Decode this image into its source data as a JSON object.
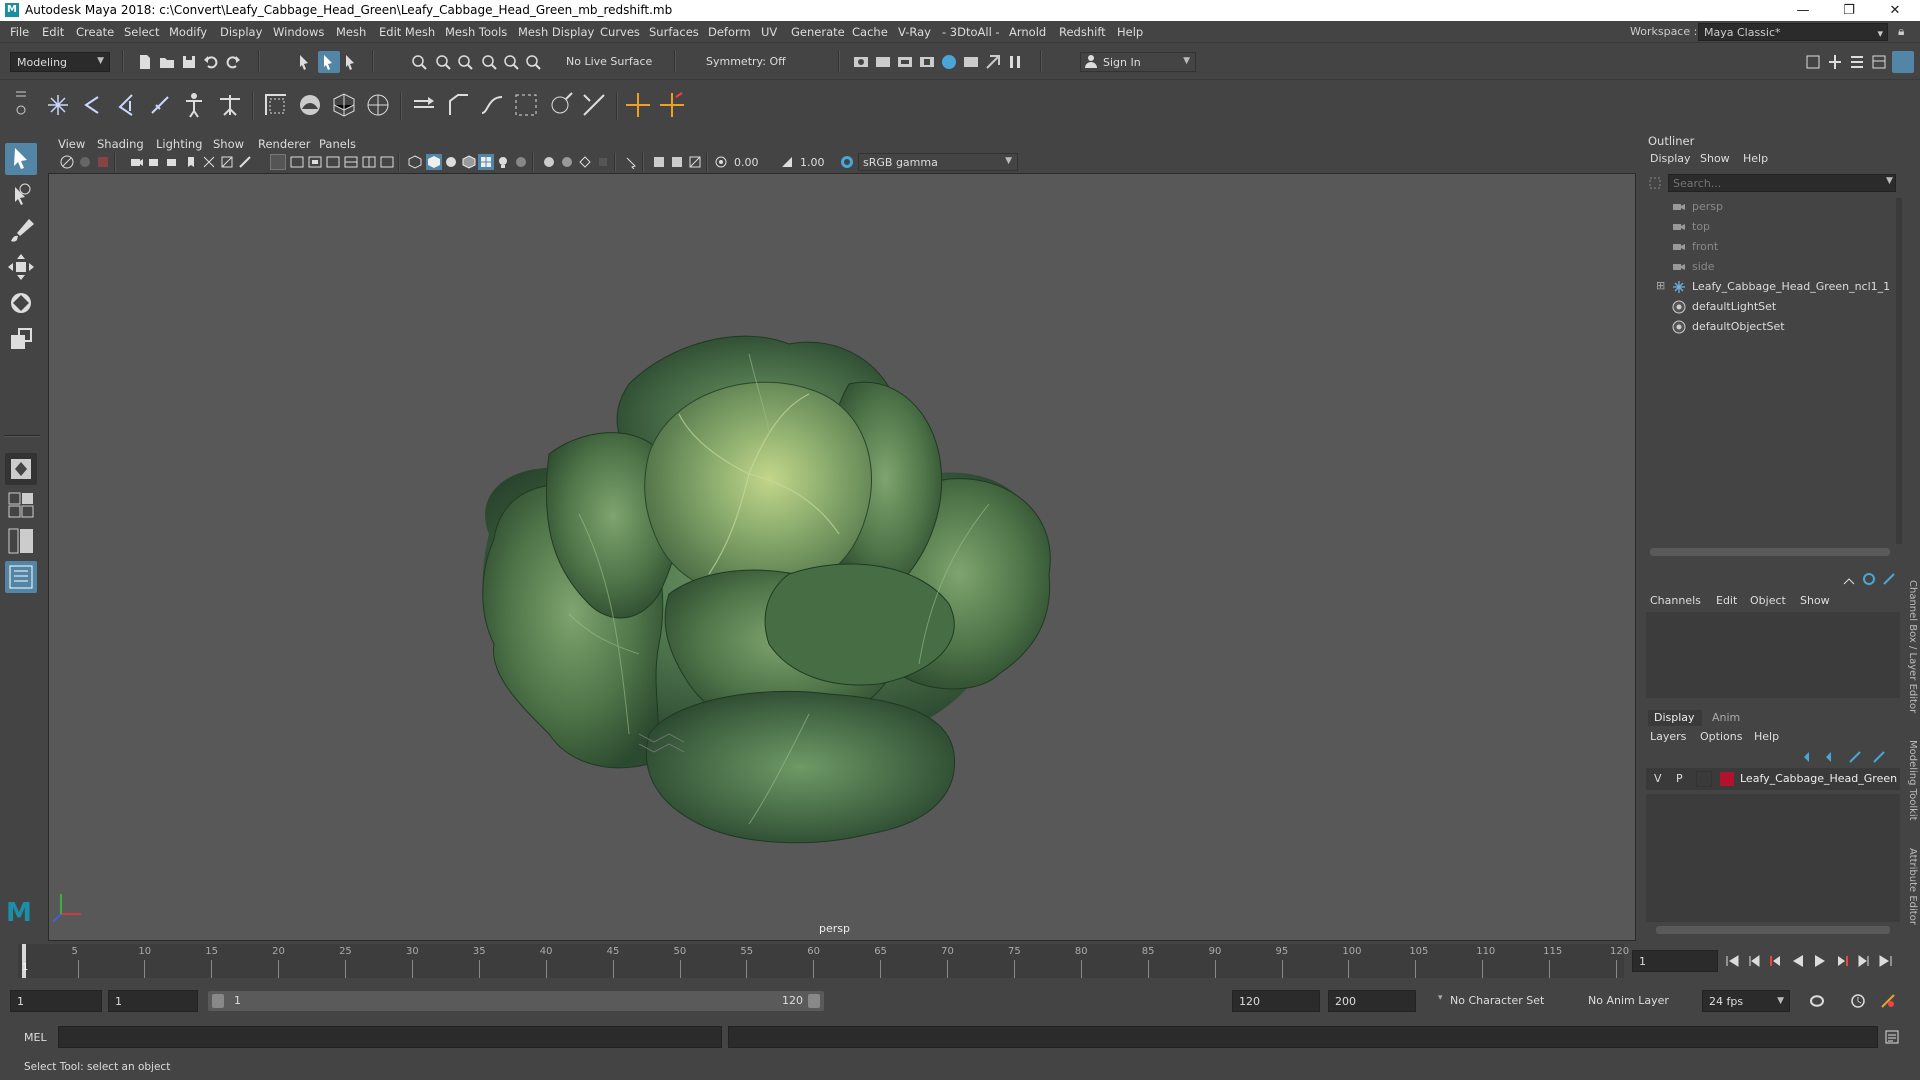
{
  "window": {
    "title": "Autodesk Maya 2018: c:\\Convert\\Leafy_Cabbage_Head_Green\\Leafy_Cabbage_Head_Green_mb_redshift.mb",
    "logo": "M",
    "minimize": "—",
    "maximize": "❐",
    "close": "✕"
  },
  "menubar": {
    "items": [
      "File",
      "Edit",
      "Create",
      "Select",
      "Modify",
      "Display",
      "Windows",
      "Mesh",
      "Edit Mesh",
      "Mesh Tools",
      "Mesh Display",
      "Curves",
      "Surfaces",
      "Deform",
      "UV",
      "Generate",
      "Cache",
      "V-Ray",
      "- 3DtoAll -",
      "Arnold",
      "Redshift",
      "Help"
    ],
    "workspace_label": "Workspace :",
    "workspace_value": "Maya Classic*"
  },
  "statusline": {
    "mode": "Modeling",
    "live_surface": "No Live Surface",
    "symmetry": "Symmetry: Off",
    "sign_in": "Sign In"
  },
  "panel": {
    "menu": [
      "View",
      "Shading",
      "Lighting",
      "Show",
      "Renderer",
      "Panels"
    ],
    "exposure": "0.00",
    "gamma": "1.00",
    "color_space": "sRGB gamma",
    "camera_label": "persp"
  },
  "outliner": {
    "title": "Outliner",
    "menu": [
      "Display",
      "Show",
      "Help"
    ],
    "search_placeholder": "Search...",
    "items": [
      {
        "label": "persp",
        "type": "camera",
        "dim": true
      },
      {
        "label": "top",
        "type": "camera",
        "dim": true
      },
      {
        "label": "front",
        "type": "camera",
        "dim": true
      },
      {
        "label": "side",
        "type": "camera",
        "dim": true
      },
      {
        "label": "Leafy_Cabbage_Head_Green_ncl1_1",
        "type": "transform",
        "dim": false,
        "expandable": "⊞"
      },
      {
        "label": "defaultLightSet",
        "type": "set",
        "dim": false
      },
      {
        "label": "defaultObjectSet",
        "type": "set",
        "dim": false
      }
    ]
  },
  "channelbox": {
    "menu": [
      "Channels",
      "Edit",
      "Object",
      "Show"
    ]
  },
  "layer_editor": {
    "tabs": [
      "Display",
      "Anim"
    ],
    "menu": [
      "Layers",
      "Options",
      "Help"
    ],
    "layer": {
      "v": "V",
      "p": "P",
      "name": "Leafy_Cabbage_Head_Green",
      "color": "#b3122c"
    }
  },
  "side_tabs": [
    "Channel Box / Layer Editor",
    "Modeling Toolkit",
    "Attribute Editor"
  ],
  "timeline": {
    "ticks": [
      "1",
      "5",
      "10",
      "15",
      "20",
      "25",
      "30",
      "35",
      "40",
      "45",
      "50",
      "55",
      "60",
      "65",
      "70",
      "75",
      "80",
      "85",
      "90",
      "95",
      "100",
      "105",
      "110",
      "115",
      "120"
    ],
    "current_frame": "1",
    "range_start": "1",
    "playback_start": "1",
    "range_slider_start": "1",
    "range_slider_end": "120",
    "playback_end": "120",
    "range_end": "200",
    "character_set": "No Character Set",
    "anim_layer": "No Anim Layer",
    "fps": "24 fps"
  },
  "commandline": {
    "label": "MEL"
  },
  "helpline": {
    "text": "Select Tool: select an object"
  },
  "colors": {
    "ui_bg": "#444444",
    "viewport_bg": "#585858",
    "accent_blue": "#5285a6",
    "maya_logo_teal": "#1b8f9e",
    "layer_red": "#b3122c"
  }
}
